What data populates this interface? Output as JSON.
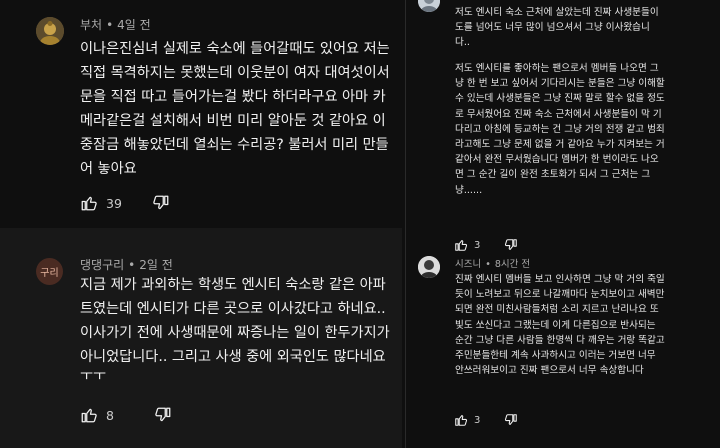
{
  "left_comments": [
    {
      "author": "부처",
      "time": "4일 전",
      "lines": [
        "이나은진심녀 실제로 숙소에 들어갈때도 있어요 저는",
        "직접 목격하지는 못했는데 이웃분이 여자 대여섯이서",
        "문을 직접 따고 들어가는걸 봤다 하더라구요 아마 카",
        "메라같은걸 설치해서 비번 미리 알아둔 것 같아요 이",
        "중잠금 해놓았던데 열쇠는 수리공? 불러서 미리 만들",
        "어 놓아요"
      ],
      "likes": "39"
    },
    {
      "author": "댕댕구리",
      "time": "2일 전",
      "avatar_text": "구리",
      "lines": [
        "지금 제가 과외하는 학생도 엔시티 숙소랑 같은 아파",
        "트였는데 엔시티가 다른 곳으로 이사갔다고 하네요..",
        "이사가기 전에 사생때문에 짜증나는 일이 한두가지가",
        "아니었답니다.. 그리고 사생 중에 외국인도 많다네요",
        "ㅜㅜ"
      ],
      "likes": "8"
    }
  ],
  "right_comments": [
    {
      "lines": [
        "저도 엔시티 숙소 근처에 살았는데 진짜 사생분들이",
        "도를 넘어도 너무 많이 넘으셔서 그냥 이사왔습니",
        "다.."
      ]
    },
    {
      "lines": [
        "저도 엔시티를 좋아하는 팬으로서 멤버들 나오면 그",
        "냥 한 번 보고 싶어서 기다리시는 분들은 그냥 이해할",
        "수 있는데 사생분들은 그냥 진짜 말로 할수 없을 정도",
        "로 무서웠어요 진짜 숙소 근처에서 사생분들이 막 기",
        "다리고 아침에 등교하는 건 그냥 거의 전쟁 같고 범죄",
        "라고해도 그냥 문제 없을 거 같아요 누가 지켜보는 거",
        "같아서 완전 무서웠습니다 멤버가 한 번이라도 나오",
        "면 그 순간 길이 완전 초토화가 되서 그 근처는 그",
        "냥......"
      ],
      "likes": "3"
    },
    {
      "author": "시즈니",
      "time": "8시간 전",
      "lines": [
        "진짜 엔시티 멤버들 보고 인사하면 그냥 막 거의 죽일",
        "듯이 노려보고 뒤으로 나갈깨마다 눈치보이고 새벽만",
        "되면 완전 미친사람들처럼 소리 지르고 난리나요 또",
        "빛도 쏘신다고 그랬는데 이게 다른집으로 반사되는",
        "순간 그냥 다른 사람들 한명씩 다 깨우는 거랑 똑같고",
        "주민분들한테 계속 사과하시고 이러는 거보면 너무",
        "안쓰러워보이고 진짜 팬으로서 너무 속상합니다"
      ],
      "likes": "3"
    }
  ],
  "ui": {
    "separator": "•",
    "like_icon": "thumbs-up-icon",
    "dislike_icon": "thumbs-down-icon",
    "avatar_bg_guri": "#4a2b22",
    "avatar_text_color": "#e8b7a0"
  }
}
